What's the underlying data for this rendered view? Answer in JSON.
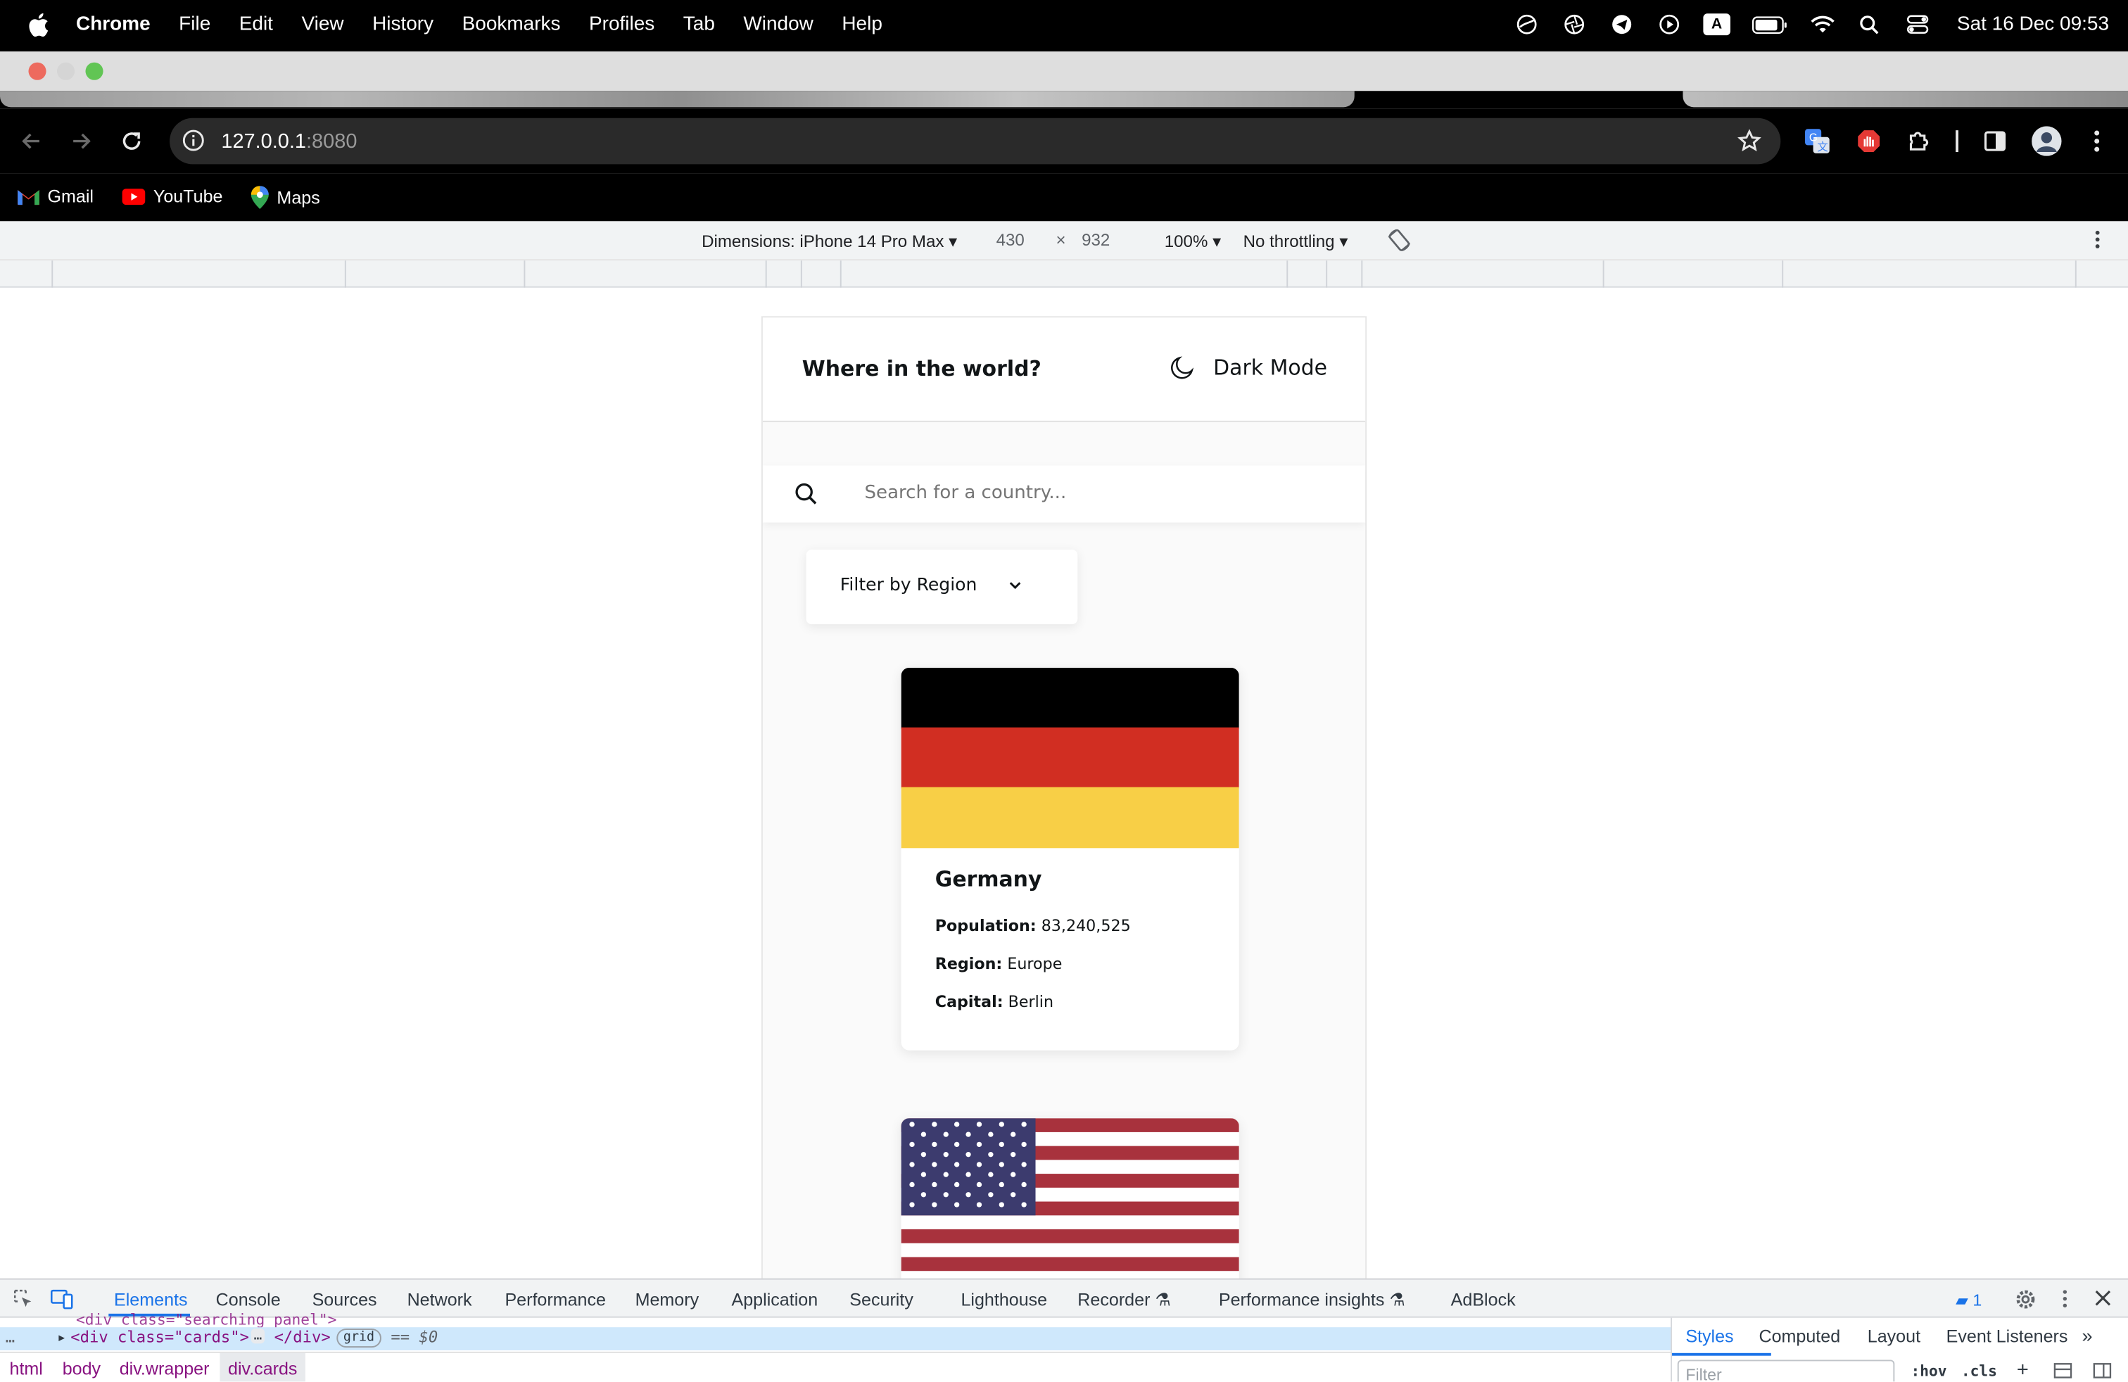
{
  "menubar": {
    "app": "Chrome",
    "menus": [
      "File",
      "Edit",
      "View",
      "History",
      "Bookmarks",
      "Profiles",
      "Tab",
      "Window",
      "Help"
    ],
    "input_indicator": "A",
    "clock": "Sat 16 Dec  09:53"
  },
  "browser": {
    "url_host": "127.0.0.1",
    "url_port": ":8080",
    "bookmarks": [
      "Gmail",
      "YouTube",
      "Maps"
    ]
  },
  "device_toolbar": {
    "dimensions": "Dimensions: iPhone 14 Pro Max",
    "width": "430",
    "times": "×",
    "height": "932",
    "zoom": "100%",
    "throttling": "No throttling"
  },
  "app": {
    "title": "Where in the world?",
    "dark_mode_label": "Dark Mode",
    "search_placeholder": "Search for a country...",
    "filter_label": "Filter by Region",
    "cards": [
      {
        "name": "Germany",
        "population_label": "Population:",
        "population": "83,240,525",
        "region_label": "Region:",
        "region": "Europe",
        "capital_label": "Capital:",
        "capital": "Berlin",
        "flag": "germany-flag"
      },
      {
        "flag": "usa-flag"
      }
    ]
  },
  "devtools": {
    "tabs": [
      "Elements",
      "Console",
      "Sources",
      "Network",
      "Performance",
      "Memory",
      "Application",
      "Security",
      "Lighthouse",
      "Recorder",
      "Performance insights",
      "AdBlock"
    ],
    "active_tab": "Elements",
    "issues_count": "1",
    "dom_line_partial": "<div class=\"searching_panel\">",
    "dom_line": "<div class=\"cards\">",
    "dom_ellipsis": "…",
    "dom_close": "</div>",
    "dom_badge": "grid",
    "dom_ref": "== $0",
    "breadcrumbs": [
      "html",
      "body",
      "div.wrapper",
      "div.cards"
    ],
    "side_tabs": [
      "Styles",
      "Computed",
      "Layout",
      "Event Listeners"
    ],
    "filter_placeholder": "Filter",
    "hov": ":hov",
    "cls": ".cls"
  },
  "colors": {
    "accent": "#1a73e8",
    "germany_black": "#000000",
    "germany_red": "#dd0000",
    "germany_gold": "#ffce00",
    "usa_red": "#b22234",
    "usa_blue": "#3c3b6e"
  }
}
